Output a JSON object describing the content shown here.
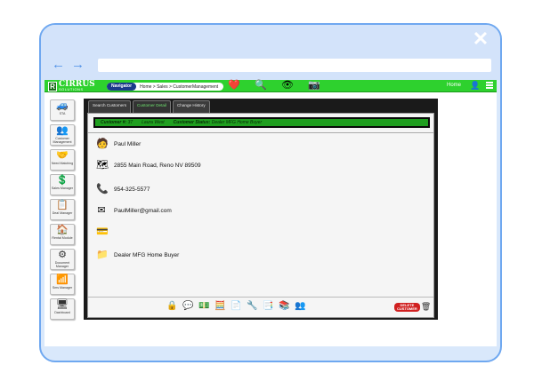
{
  "app": {
    "logo_mark": "R",
    "logo_text": "CIRRUS",
    "logo_sub": "SOLUTIONS",
    "navigator_label": "Navigator",
    "breadcrumb": "Home > Sales > CustomerManagement",
    "home_label": "Home",
    "top_icons": [
      "heart-monitor-icon",
      "search-users-icon",
      "search-eye-icon",
      "camera-icon"
    ]
  },
  "sidebar": {
    "items": [
      {
        "label": "STA",
        "icon": "sta-icon"
      },
      {
        "label": "Customer Management",
        "icon": "customer-management-icon"
      },
      {
        "label": "Need Matching",
        "icon": "need-matching-icon"
      },
      {
        "label": "Sales Manager",
        "icon": "sales-manager-icon"
      },
      {
        "label": "Deal Manager",
        "icon": "deal-manager-icon"
      },
      {
        "label": "Rental Module",
        "icon": "rental-module-icon"
      },
      {
        "label": "Document Manager",
        "icon": "document-manager-icon"
      },
      {
        "label": "Sms Manager",
        "icon": "sms-manager-icon"
      },
      {
        "label": "Dashboard",
        "icon": "dashboard-icon"
      }
    ]
  },
  "tabs": [
    {
      "label": "Search Customers",
      "active": false
    },
    {
      "label": "Customer Detail",
      "active": true
    },
    {
      "label": "Change History",
      "active": false
    }
  ],
  "status": {
    "customer_label": "Customer #:",
    "customer_number": "37",
    "agent": "Laura West",
    "status_label": "Customer Status:",
    "status_value": "Dealer MFG Home Buyer"
  },
  "customer": {
    "name": "Paul Miller",
    "address": "2855 Main Road, Reno NV 89509",
    "phone": "954-325-5577",
    "email": "PaulMiller@gmail.com",
    "extra": "",
    "type": "Dealer MFG Home Buyer"
  },
  "toolbar": {
    "tools": [
      "lock-icon",
      "chat-icon",
      "money-icon",
      "calculator-icon",
      "document-icon",
      "tools-icon",
      "pdf-icon",
      "stack-icon",
      "add-user-icon"
    ],
    "delete_label_1": "DELETE",
    "delete_label_2": "CUSTOMER"
  },
  "colors": {
    "appbar": "#2ed12e",
    "status_bar": "#1f9f1f",
    "navigator": "#1b3a8a",
    "delete": "#d02020"
  }
}
